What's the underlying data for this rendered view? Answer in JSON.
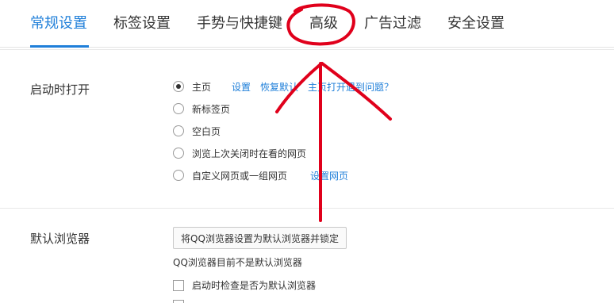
{
  "tabs": [
    {
      "label": "常规设置",
      "active": true
    },
    {
      "label": "标签设置",
      "active": false
    },
    {
      "label": "手势与快捷键",
      "active": false
    },
    {
      "label": "高级",
      "active": false
    },
    {
      "label": "广告过滤",
      "active": false
    },
    {
      "label": "安全设置",
      "active": false
    }
  ],
  "startup": {
    "label": "启动时打开",
    "options": [
      {
        "label": "主页",
        "checked": true
      },
      {
        "label": "新标签页",
        "checked": false
      },
      {
        "label": "空白页",
        "checked": false
      },
      {
        "label": "浏览上次关闭时在看的网页",
        "checked": false
      },
      {
        "label": "自定义网页或一组网页",
        "checked": false
      }
    ],
    "home_links": {
      "settings": "设置",
      "restore": "恢复默认",
      "help": "主页打开遇到问题？"
    },
    "custom_link": "设置网页"
  },
  "default_browser": {
    "label": "默认浏览器",
    "set_button": "将QQ浏览器设置为默认浏览器并锁定",
    "status": "QQ浏览器目前不是默认浏览器",
    "check_on_start": "启动时检查是否为默认浏览器"
  },
  "colors": {
    "accent": "#1f7fd9",
    "annotation": "#e0001b"
  }
}
